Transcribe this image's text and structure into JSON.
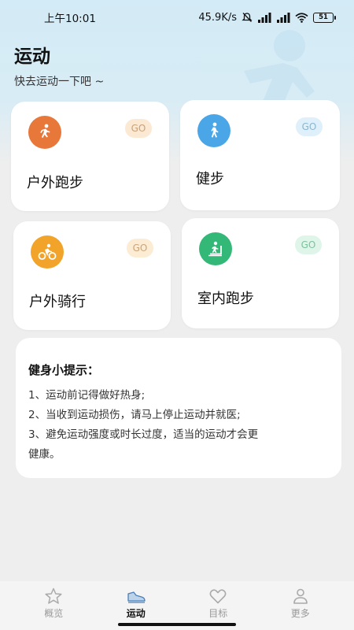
{
  "status_bar": {
    "time": "上午10:01",
    "speed": "45.9K/s",
    "battery": "51"
  },
  "header": {
    "title": "运动",
    "subtitle": "快去运动一下吧 ~"
  },
  "cards": [
    {
      "label": "户外跑步",
      "go": "GO",
      "icon": "outdoor-run-icon",
      "color": "#e8773a",
      "go_bg": "#fbe9d3",
      "go_color": "#c8a27a"
    },
    {
      "label": "健步",
      "go": "GO",
      "icon": "walk-icon",
      "color": "#4aa6e6",
      "go_bg": "#dff0fa",
      "go_color": "#8ab6cf"
    },
    {
      "label": "户外骑行",
      "go": "GO",
      "icon": "bike-icon",
      "color": "#f1a429",
      "go_bg": "#fcecd3",
      "go_color": "#caa57a"
    },
    {
      "label": "室内跑步",
      "go": "GO",
      "icon": "treadmill-icon",
      "color": "#33b877",
      "go_bg": "#dff5ea",
      "go_color": "#7fbf9d"
    }
  ],
  "tips": {
    "title": "健身小提示：",
    "lines": [
      "1、运动前记得做好热身;",
      "2、当收到运动损伤，请马上停止运动并就医;",
      "3、避免运动强度或时长过度，适当的运动才会更",
      "健康。"
    ]
  },
  "tabs": [
    {
      "label": "概览",
      "icon": "star-icon",
      "active": false
    },
    {
      "label": "运动",
      "icon": "sneaker-icon",
      "active": true
    },
    {
      "label": "目标",
      "icon": "heart-icon",
      "active": false
    },
    {
      "label": "更多",
      "icon": "person-icon",
      "active": false
    }
  ]
}
